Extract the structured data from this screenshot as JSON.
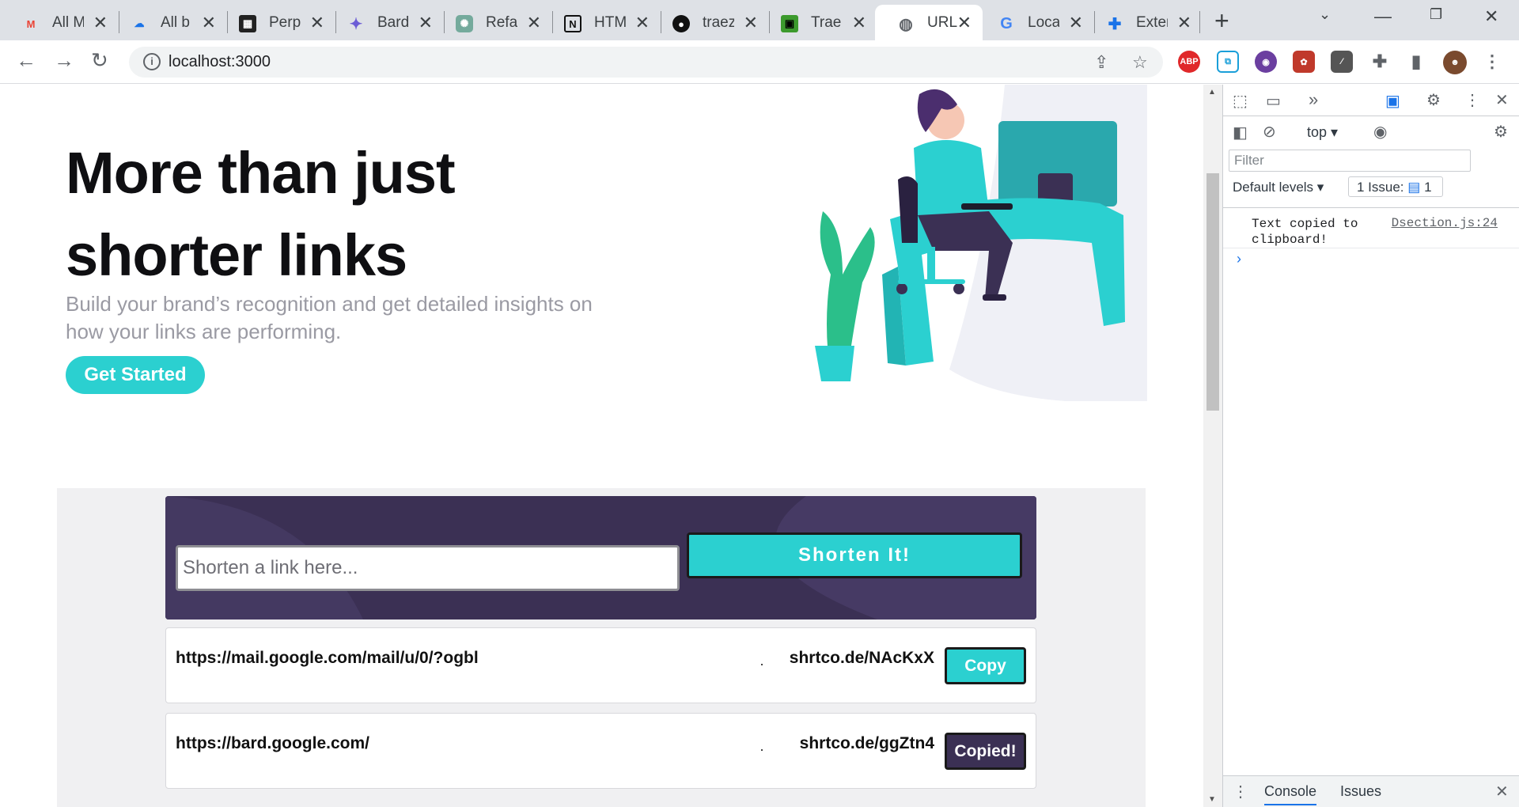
{
  "browser": {
    "tabs": [
      {
        "title": "All M",
        "icon": "gmail-icon"
      },
      {
        "title": "All b",
        "icon": "cloud-icon"
      },
      {
        "title": "Perpl",
        "icon": "perplexity-icon"
      },
      {
        "title": "Bard",
        "icon": "bard-icon"
      },
      {
        "title": "Refac",
        "icon": "chatgpt-icon"
      },
      {
        "title": "HTM",
        "icon": "notion-icon"
      },
      {
        "title": "traez",
        "icon": "github-icon"
      },
      {
        "title": "Trae",
        "icon": "pixel-icon"
      },
      {
        "title": "URL",
        "icon": "globe-icon",
        "active": true
      },
      {
        "title": "Local",
        "icon": "google-icon"
      },
      {
        "title": "Exter",
        "icon": "puzzle-icon"
      }
    ],
    "url": "localhost:3000",
    "extensions": [
      "ABP"
    ]
  },
  "hero": {
    "title_line1": "More than just",
    "title_line2": "shorter links",
    "subtitle": "Build your brand’s recognition and get detailed insights on how your links are performing.",
    "cta_label": "Get Started"
  },
  "shortener": {
    "placeholder": "Shorten a link here...",
    "button_label": "Shorten It!"
  },
  "results": [
    {
      "original": "https://mail.google.com/mail/u/0/?ogbl",
      "short": "shrtco.de/NAcKxX",
      "button": "Copy",
      "button_color": "#2bd0d0"
    },
    {
      "original": "https://bard.google.com/",
      "short": "shrtco.de/ggZtn4",
      "button": "Copied!",
      "button_color": "#3b3054"
    }
  ],
  "devtools": {
    "context": "top",
    "filter_placeholder": "Filter",
    "levels": "Default levels",
    "issues": "1 Issue:",
    "issue_count": "1",
    "console_message": "Text copied to clipboard!",
    "console_source": "Dsection.js:24",
    "bottom_tabs": [
      "Console",
      "Issues"
    ]
  },
  "colors": {
    "accent": "#2bd0d0",
    "dark_violet": "#3b3054"
  }
}
